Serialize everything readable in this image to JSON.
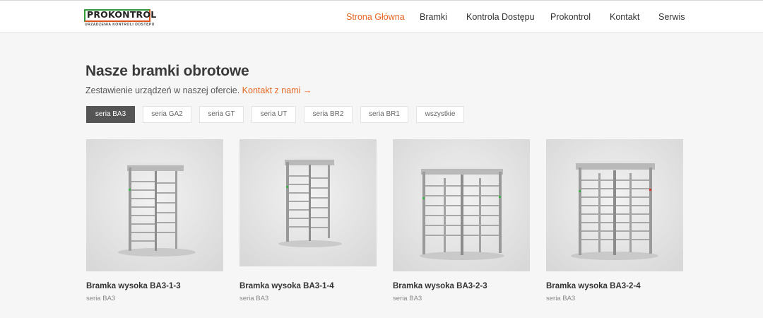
{
  "brand": {
    "logo_text": "PROKONTROL",
    "logo_tagline": "URZĄDZENIA KONTROLI DOSTĘPU",
    "colors": {
      "green": "#2e9a3a",
      "orange": "#e1541c",
      "accent": "#e56622"
    }
  },
  "nav": {
    "items": [
      {
        "label": "Strona Główna",
        "active": true
      },
      {
        "label": "Bramki",
        "active": false
      },
      {
        "label": "Kontrola Dostępu",
        "active": false
      },
      {
        "label": "Prokontrol",
        "active": false
      },
      {
        "label": "Kontakt",
        "active": false
      },
      {
        "label": "Serwis",
        "active": false
      }
    ]
  },
  "main": {
    "title": "Nasze bramki obrotowe",
    "subtitle": "Zestawienie urządzeń w naszej ofercie.",
    "contact_link": "Kontakt z nami →",
    "filters": [
      {
        "label": "seria BA3",
        "active": true
      },
      {
        "label": "seria GA2",
        "active": false
      },
      {
        "label": "seria GT",
        "active": false
      },
      {
        "label": "seria UT",
        "active": false
      },
      {
        "label": "seria BR2",
        "active": false
      },
      {
        "label": "seria BR1",
        "active": false
      },
      {
        "label": "wszystkie",
        "active": false
      }
    ],
    "products": [
      {
        "title": "Bramka wysoka BA3-1-3",
        "series": "seria BA3",
        "image": "turnstile-single-icon"
      },
      {
        "title": "Bramka wysoka BA3-1-4",
        "series": "seria BA3",
        "image": "turnstile-single-icon"
      },
      {
        "title": "Bramka wysoka BA3-2-3",
        "series": "seria BA3",
        "image": "turnstile-double-icon"
      },
      {
        "title": "Bramka wysoka BA3-2-4",
        "series": "seria BA3",
        "image": "turnstile-double-icon"
      }
    ]
  }
}
